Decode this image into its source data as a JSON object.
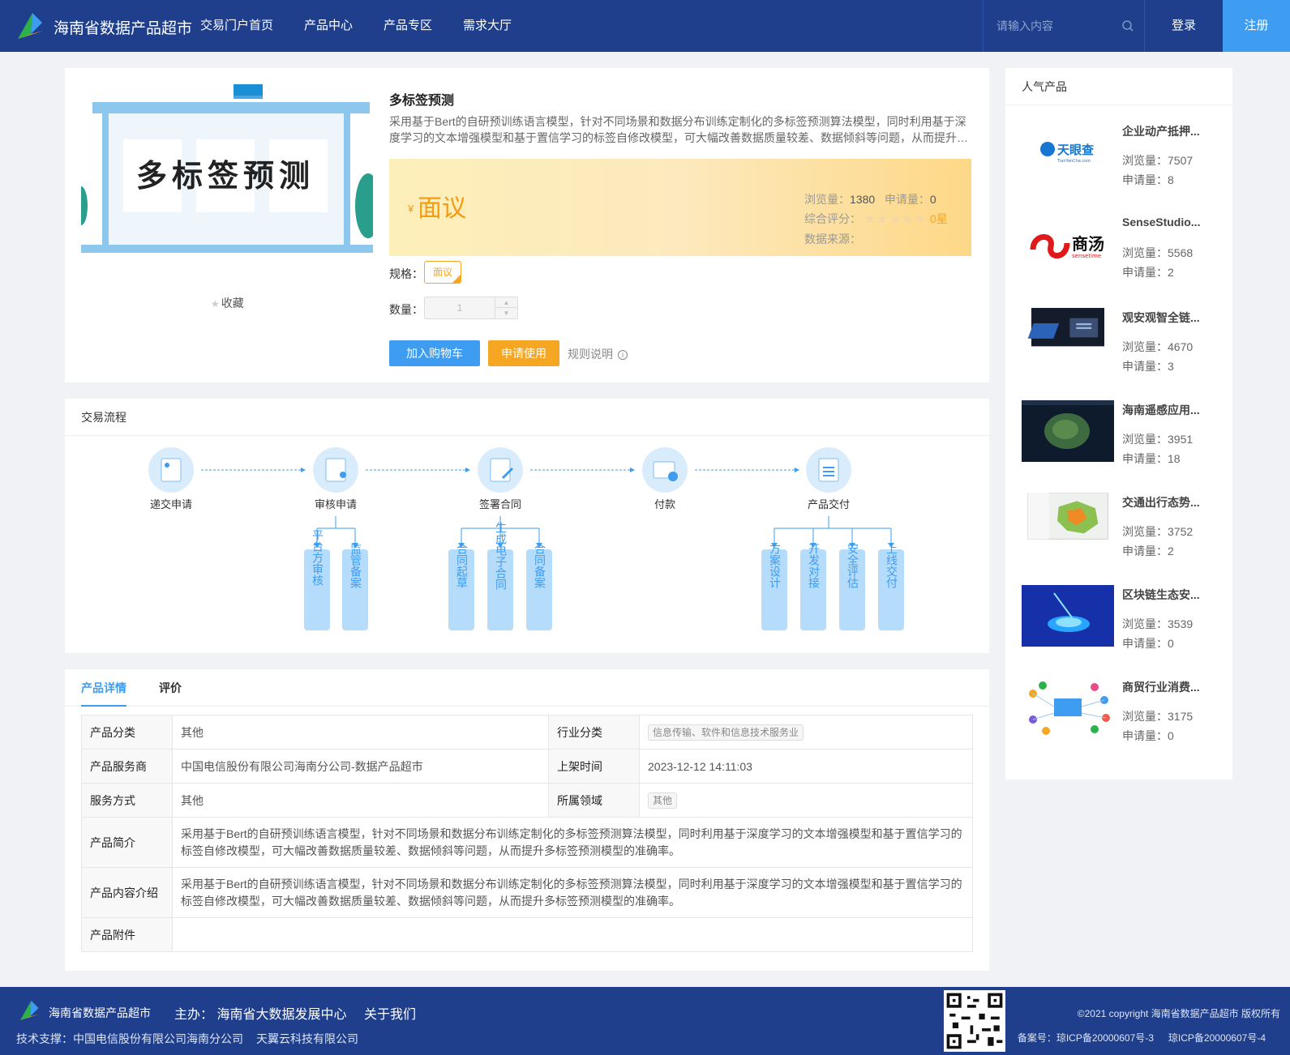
{
  "header": {
    "site_title": "海南省数据产品超市",
    "nav": [
      "交易门户首页",
      "产品中心",
      "产品专区",
      "需求大厅"
    ],
    "search_placeholder": "请输入内容",
    "login": "登录",
    "register": "注册"
  },
  "product": {
    "image_text": "多标签预测",
    "favorite": "收藏",
    "title": "多标签预测",
    "description": "采用基于Bert的自研预训练语言模型，针对不同场景和数据分布训练定制化的多标签预测算法模型，同时利用基于深度学习的文本增强模型和基于置信学习的标签自修改模型，可大幅改善数据质量较差、数据倾斜等问题，从而提升多标签预测模型的准确率。",
    "currency": "¥",
    "price": "面议",
    "views_label": "浏览量：",
    "views": "1380",
    "applies_label": "申请量：",
    "applies": "0",
    "rating_label": "综合评分：",
    "rating_value": "0星",
    "rating_stars": 0,
    "source_label": "数据来源：",
    "spec_label": "规格：",
    "spec_value": "面议",
    "qty_label": "数量：",
    "qty_value": "1",
    "btn_cart": "加入购物车",
    "btn_apply": "申请使用",
    "rules": "规则说明"
  },
  "flow": {
    "title": "交易流程",
    "steps": [
      "递交申请",
      "审核申请",
      "签署合同",
      "付款",
      "产品交付"
    ],
    "sub": {
      "review": [
        "平台方审核",
        "监管备案"
      ],
      "contract": [
        "合同起草",
        "生成电子合同",
        "合同备案"
      ],
      "delivery": [
        "方案设计",
        "开发对接",
        "安全评估",
        "上线交付"
      ]
    }
  },
  "detail": {
    "tabs": [
      "产品详情",
      "评价"
    ],
    "rows": {
      "category_k": "产品分类",
      "category_v": "其他",
      "industry_k": "行业分类",
      "industry_v": "信息传输、软件和信息技术服务业",
      "provider_k": "产品服务商",
      "provider_v": "中国电信股份有限公司海南分公司-数据产品超市",
      "listed_k": "上架时间",
      "listed_v": "2023-12-12 14:11:03",
      "service_k": "服务方式",
      "service_v": "其他",
      "domain_k": "所属领域",
      "domain_v": "其他",
      "intro_k": "产品简介",
      "intro_v": "采用基于Bert的自研预训练语言模型，针对不同场景和数据分布训练定制化的多标签预测算法模型，同时利用基于深度学习的文本增强模型和基于置信学习的标签自修改模型，可大幅改善数据质量较差、数据倾斜等问题，从而提升多标签预测模型的准确率。",
      "content_k": "产品内容介绍",
      "content_v": "采用基于Bert的自研预训练语言模型，针对不同场景和数据分布训练定制化的多标签预测算法模型，同时利用基于深度学习的文本增强模型和基于置信学习的标签自修改模型，可大幅改善数据质量较差、数据倾斜等问题，从而提升多标签预测模型的准确率。",
      "attach_k": "产品附件",
      "attach_v": ""
    }
  },
  "popular": {
    "title": "人气产品",
    "views_label": "浏览量：",
    "applies_label": "申请量：",
    "items": [
      {
        "name": "企业动产抵押...",
        "views": "7507",
        "applies": "8",
        "thumb_text": "天眼查",
        "thumb_sub": "TianYanCha.com"
      },
      {
        "name": "SenseStudio...",
        "views": "5568",
        "applies": "2",
        "thumb_text": "商汤",
        "thumb_sub": "sensetime"
      },
      {
        "name": "观安观智全链...",
        "views": "4670",
        "applies": "3"
      },
      {
        "name": "海南遥感应用...",
        "views": "3951",
        "applies": "18"
      },
      {
        "name": "交通出行态势...",
        "views": "3752",
        "applies": "2"
      },
      {
        "name": "区块链生态安...",
        "views": "3539",
        "applies": "0"
      },
      {
        "name": "商贸行业消费...",
        "views": "3175",
        "applies": "0"
      }
    ]
  },
  "footer": {
    "title": "海南省数据产品超市",
    "host": "主办： 海南省大数据发展中心",
    "about": "关于我们",
    "support_label": "技术支撑：中国电信股份有限公司海南分公司",
    "support_2": "天翼云科技有限公司",
    "copyright": "©2021 copyright 海南省数据产品超市 版权所有",
    "icp1": "备案号：琼ICP备20000607号-3",
    "icp2": "琼ICP备20000607号-4"
  },
  "colors": {
    "primary": "#1f3f8c",
    "accent": "#3e9cf1",
    "orange": "#f5a623"
  }
}
